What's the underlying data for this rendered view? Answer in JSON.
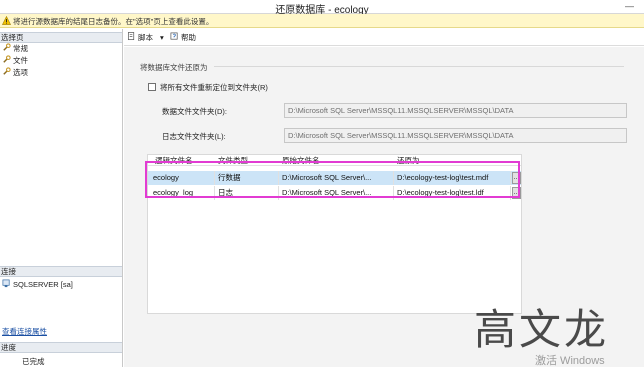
{
  "window": {
    "title": "还原数据库 - ecology",
    "minimize_glyph": "—"
  },
  "warning": {
    "icon": "warning-icon",
    "text": "将进行源数据库的结尾日志备份。在\"选项\"页上查看此设置。"
  },
  "sidebar": {
    "pages_header": "选择页",
    "pages": [
      {
        "label": "常规",
        "icon": "wrench-icon"
      },
      {
        "label": "文件",
        "icon": "wrench-icon"
      },
      {
        "label": "选项",
        "icon": "wrench-icon"
      }
    ],
    "connection_header": "连接",
    "connection_item": {
      "label": "SQLSERVER [sa]",
      "icon": "server-icon"
    },
    "connection_link": "查看连接属性",
    "progress_header": "进度",
    "progress_item": "已完成"
  },
  "toolbar": {
    "script_label": "脚本",
    "script_dropdown": "▾",
    "help_label": "帮助"
  },
  "main": {
    "section_title": "将数据库文件还原为",
    "relocate_checkbox": {
      "label": "将所有文件重新定位到文件夹(R)",
      "checked": false
    },
    "data_folder": {
      "label": "数据文件文件夹(D):",
      "value": "D:\\Microsoft SQL Server\\MSSQL11.MSSQLSERVER\\MSSQL\\DATA"
    },
    "log_folder": {
      "label": "日志文件文件夹(L):",
      "value": "D:\\Microsoft SQL Server\\MSSQL11.MSSQLSERVER\\MSSQL\\DATA"
    }
  },
  "grid": {
    "columns": [
      "逻辑文件名",
      "文件类型",
      "原始文件名",
      "还原为"
    ],
    "rows": [
      {
        "logical": "ecology",
        "type": "行数据",
        "original": "D:\\Microsoft SQL Server\\...",
        "restore_as": "D:\\ecology-test-log\\test.mdf",
        "browse": "...",
        "selected": true
      },
      {
        "logical": "ecology_log",
        "type": "日志",
        "original": "D:\\Microsoft SQL Server\\...",
        "restore_as": "D:\\ecology-test-log\\test.ldf",
        "browse": "...",
        "selected": false
      }
    ]
  },
  "overlay": {
    "watermark": "高文龙",
    "activate": "激活 Windows",
    "highlight_color": "#e23bd3"
  }
}
